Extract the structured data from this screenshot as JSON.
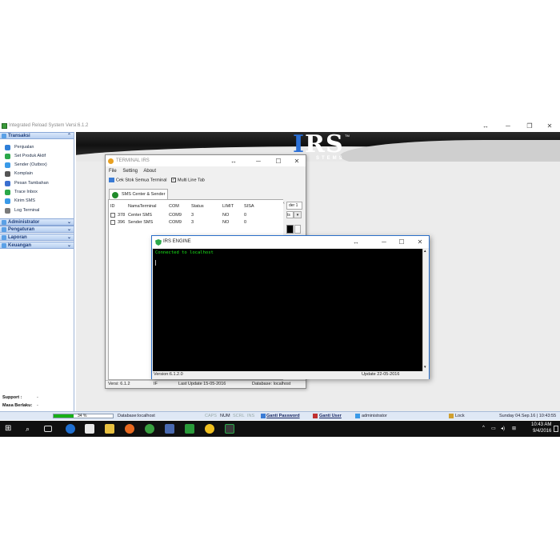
{
  "main": {
    "title": "Integrated Reload System Versi:6.1.2",
    "controls": {
      "dblarrow": "↔",
      "minimize": "─",
      "restore": "❐",
      "close": "✕"
    }
  },
  "sidebar": {
    "sections": [
      {
        "label": "Transaksi",
        "chevron": "⌃",
        "icon_color": "#4a90e2"
      },
      {
        "label": "Administrator",
        "chevron": "⌄",
        "icon_color": "#3a7bd5"
      },
      {
        "label": "Pengaturan",
        "chevron": "⌄",
        "icon_color": "#3a7bd5"
      },
      {
        "label": "Laporan",
        "chevron": "⌄",
        "icon_color": "#3a7bd5"
      },
      {
        "label": "Keuangan",
        "chevron": "⌄",
        "icon_color": "#3a7bd5"
      }
    ],
    "items": [
      {
        "label": "Penjualan",
        "icon_color": "#2f7fd8"
      },
      {
        "label": "Set Produk Aktif",
        "icon_color": "#2aa84a"
      },
      {
        "label": "Sender (Outbox)",
        "icon_color": "#3a9ae8"
      },
      {
        "label": "Komplain",
        "icon_color": "#555555"
      },
      {
        "label": "Pesan Tambahan",
        "icon_color": "#3a6fd0"
      },
      {
        "label": "Trace Inbox",
        "icon_color": "#2aa84a"
      },
      {
        "label": "Kirim SMS",
        "icon_color": "#3a9ae8"
      },
      {
        "label": "Log Terminal",
        "icon_color": "#7a7a7a"
      }
    ],
    "support_label": "Support :",
    "support_value": "-",
    "masa_label": "Masa Berlaku:",
    "masa_value": "-"
  },
  "banner": {
    "logo": "RS",
    "logo_i": "I",
    "subtitle": "STEMS",
    "tm": "TM"
  },
  "status_bar": {
    "progress_text": "34 %",
    "progress": 0.34,
    "database": "Database:localhost",
    "caps": "CAPS",
    "num": "NUM",
    "scrl": "SCRL",
    "ins": "INS",
    "ganti_password": "Ganti Password",
    "ganti_user": "Ganti User",
    "user": "administrator",
    "lock": "Lock",
    "datetime": "Sunday 04.Sep.16 | 10:43:55"
  },
  "terminal": {
    "title": "TERMINAL IRS",
    "controls": {
      "dblarrow": "↔",
      "minimize": "─",
      "maximize": "☐",
      "close": "✕"
    },
    "menu": [
      "File",
      "Setting",
      "About"
    ],
    "cek_stok": "Cek Stok Semua Terminal",
    "multi_line": "Multi Line Tab",
    "tab_label": "SMS Center & Sender",
    "columns": [
      "ID",
      "NamaTerminal",
      "COM",
      "Status",
      "LIMIT",
      "SISA"
    ],
    "rows": [
      {
        "id": "378",
        "name": "Center SMS",
        "com": "COM9",
        "status": "3",
        "limit": "NO",
        "sisa": "0"
      },
      {
        "id": "396",
        "name": "Sender SMS",
        "com": "COM9",
        "status": "3",
        "limit": "NO",
        "sisa": "0"
      }
    ],
    "side_tab": "der 1",
    "side_sel": "ts",
    "status": {
      "versi": "Versi: 6.1.2",
      "if": "IF",
      "last_update": "Last Update 15-05-2016",
      "database": "Database: localhost"
    }
  },
  "engine": {
    "title": "IRS ENGINE",
    "controls": {
      "dblarrow": "↔",
      "minimize": "─",
      "maximize": "☐",
      "close": "✕"
    },
    "console_line": "Connected to localhost",
    "version": "Version:6.1.2.0",
    "update": "Update 22-05-2016"
  },
  "taskbar": {
    "time": "10:43 AM",
    "date": "9/4/2016",
    "tray_icons": [
      "^",
      "▭",
      "◂)",
      "⊞"
    ]
  }
}
